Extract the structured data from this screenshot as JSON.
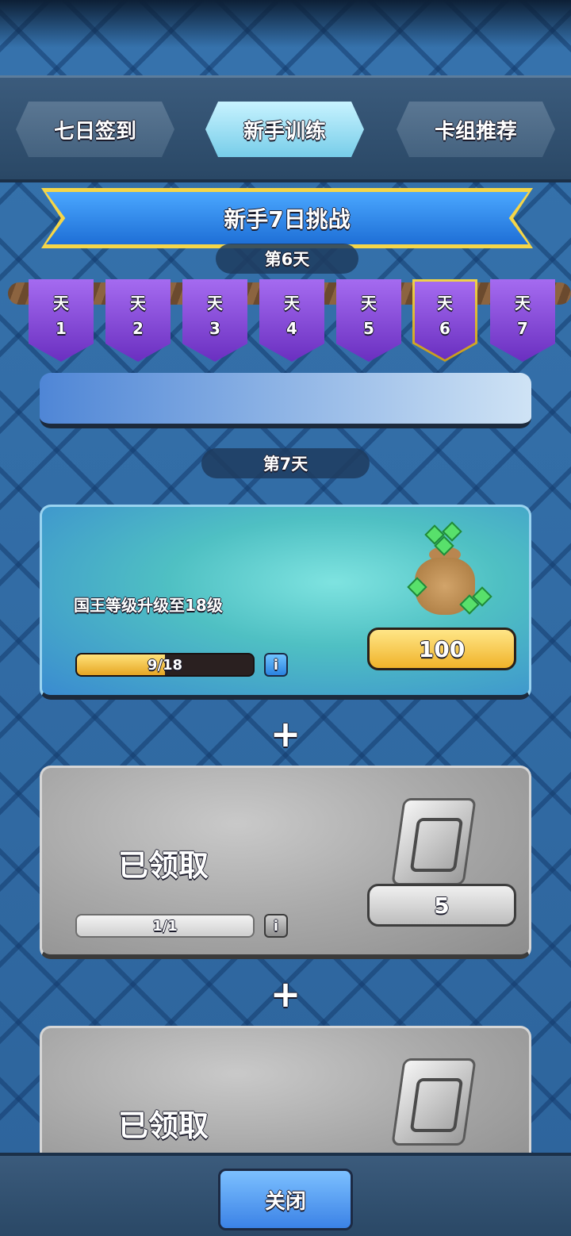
{
  "tabs": [
    "七日签到",
    "新手训练",
    "卡组推荐"
  ],
  "banner": {
    "title": "新手7日挑战",
    "current_day_label": "第6天"
  },
  "days": [
    {
      "label": "天",
      "number": "1"
    },
    {
      "label": "天",
      "number": "2"
    },
    {
      "label": "天",
      "number": "3"
    },
    {
      "label": "天",
      "number": "4"
    },
    {
      "label": "天",
      "number": "5"
    },
    {
      "label": "天",
      "number": "6"
    },
    {
      "label": "天",
      "number": "7"
    }
  ],
  "selected_day": 6,
  "section_day_label": "第7天",
  "tasks": [
    {
      "text": "国王等级升级至18级",
      "progress_label": "9/18",
      "progress_fraction": 0.5,
      "reward_value": "100",
      "reward_icon": "gem-bag-icon",
      "info_label": "i"
    },
    {
      "text": "已领取",
      "progress_label": "1/1",
      "progress_fraction": 1.0,
      "reward_value": "5",
      "reward_icon": "card-icon",
      "info_label": "i"
    },
    {
      "text": "已领取",
      "reward_icon": "card-icon"
    }
  ],
  "plus_symbol": "+",
  "footer": {
    "close_label": "关闭"
  }
}
